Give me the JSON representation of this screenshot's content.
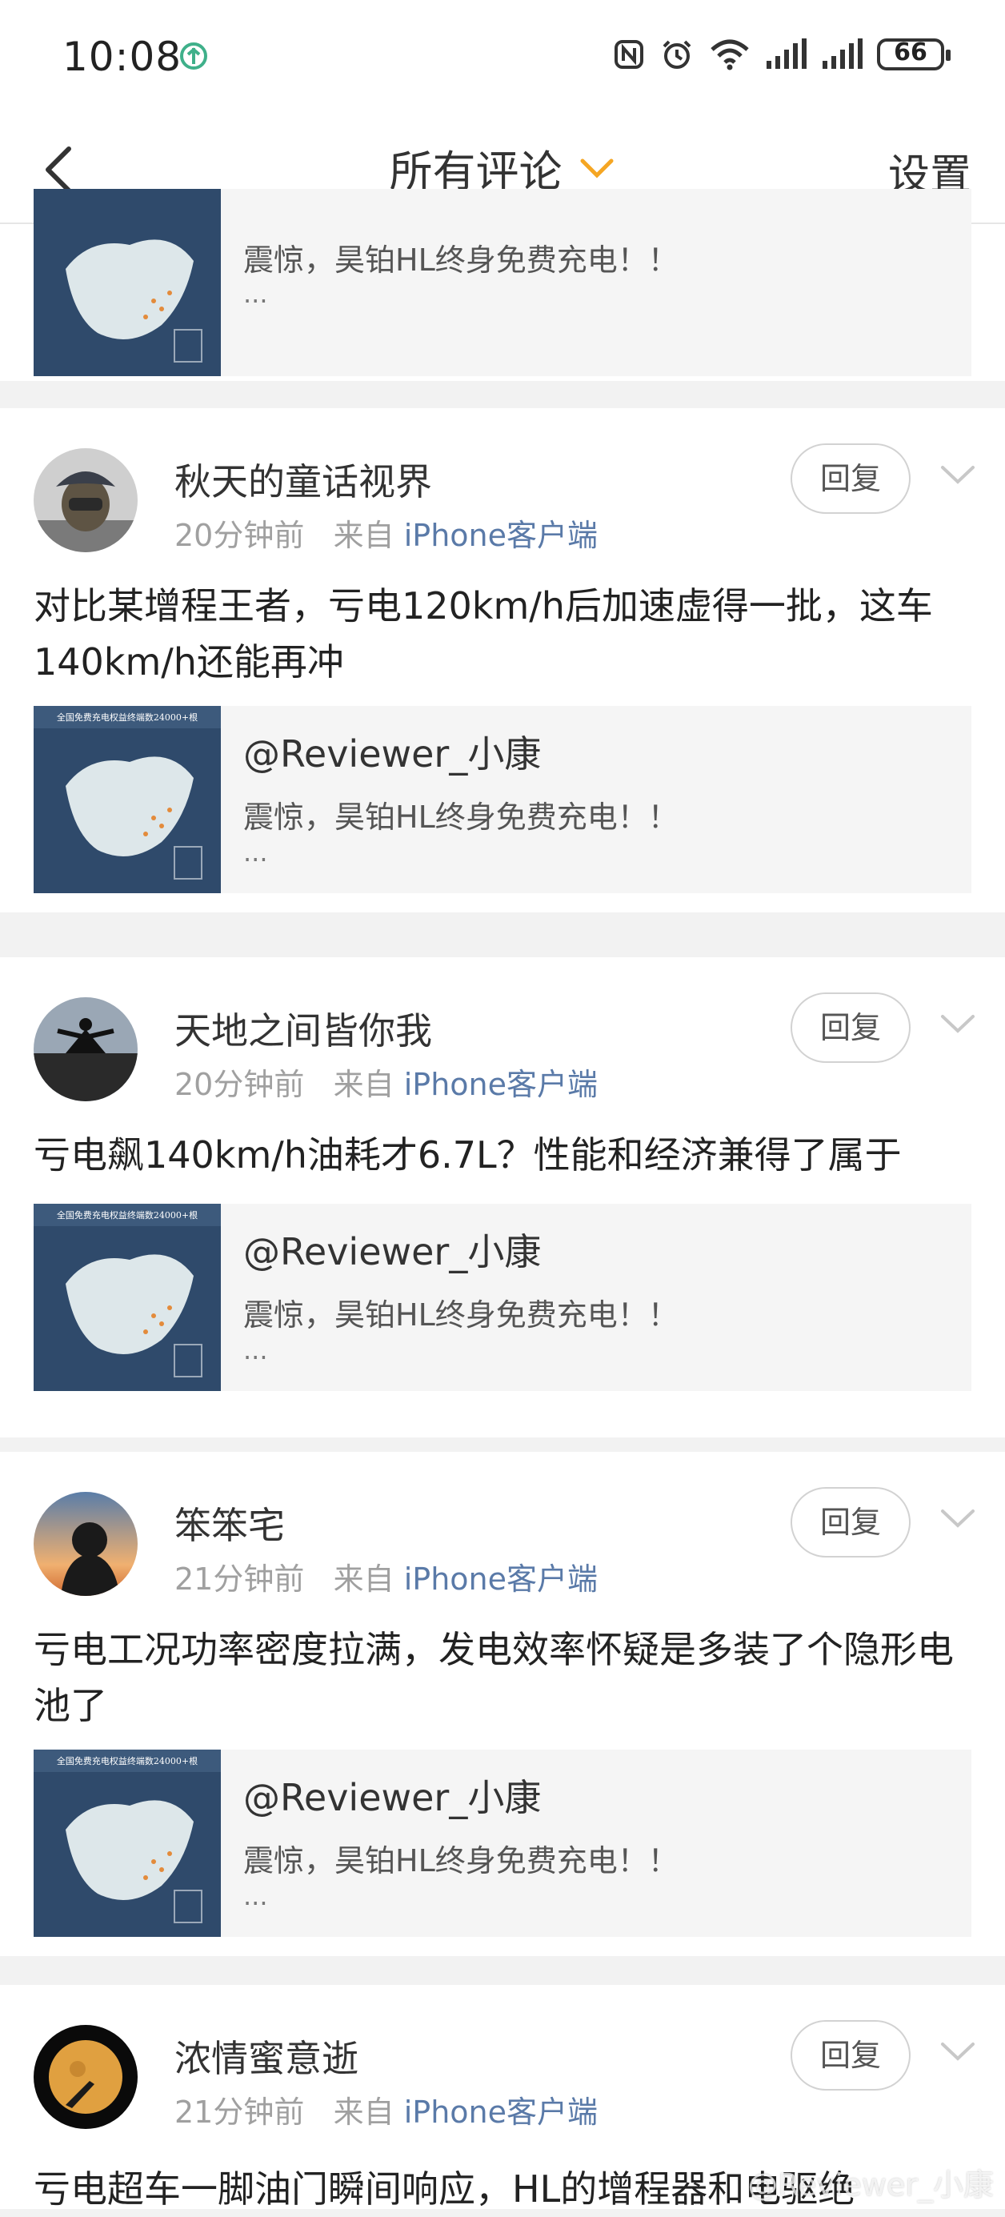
{
  "status": {
    "time": "10:08",
    "battery": "66"
  },
  "header": {
    "title": "所有评论",
    "settings": "设置"
  },
  "quote": {
    "title": "@Reviewer_小康",
    "desc": "震惊，昊铂HL终身免费充电！！",
    "ellipsis": "...",
    "image_text": "全国免费充电权益终端数24000+根"
  },
  "reply_label": "回复",
  "from_label": "来自",
  "comments": [
    {
      "name": "秋天的童话视界",
      "time": "20分钟前",
      "client": "iPhone客户端",
      "text": "对比某增程王者，亏电120km/h后加速虚得一批，这车140km/h还能再冲"
    },
    {
      "name": "天地之间皆你我",
      "time": "20分钟前",
      "client": "iPhone客户端",
      "text": "亏电飙140km/h油耗才6.7L？性能和经济兼得了属于"
    },
    {
      "name": "笨笨宅",
      "time": "21分钟前",
      "client": "iPhone客户端",
      "text": "亏电工况功率密度拉满，发电效率怀疑是多装了个隐形电池了"
    },
    {
      "name": "浓情蜜意逝",
      "time": "21分钟前",
      "client": "iPhone客户端",
      "text": "亏电超车一脚油门瞬间响应，HL的增程器和电驱绝"
    }
  ],
  "watermark": "@Reviewer_小康",
  "colors": {
    "accent": "#f5a623",
    "link": "#5a7aa8",
    "card_bg": "#ffffff",
    "divider": "#f2f2f2"
  }
}
